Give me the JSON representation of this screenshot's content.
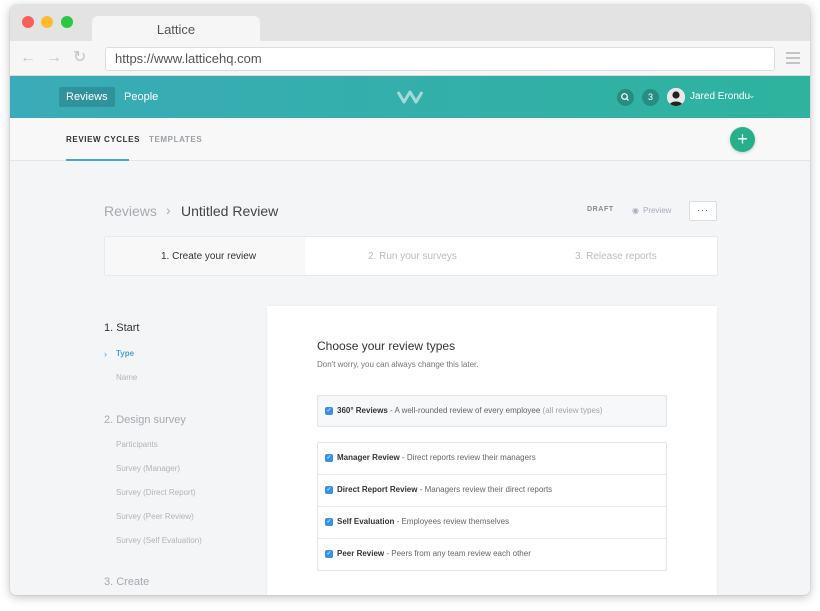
{
  "browser": {
    "tab_title": "Lattice",
    "url": "https://www.latticehq.com"
  },
  "header": {
    "nav": [
      {
        "label": "Reviews",
        "active": true
      },
      {
        "label": "People",
        "active": false
      }
    ],
    "notification_count": "3",
    "user_name": "Jared Erondu",
    "accent_gradient": [
      "#3aabb8",
      "#2db39e"
    ]
  },
  "subnav": {
    "tabs": [
      {
        "label": "REVIEW CYCLES",
        "active": true
      },
      {
        "label": "TEMPLATES",
        "active": false
      }
    ],
    "fab_label": "+"
  },
  "page": {
    "breadcrumb_root": "Reviews",
    "breadcrumb_current": "Untitled Review",
    "status": "DRAFT",
    "preview_label": "Preview",
    "more_label": "···"
  },
  "stepper": [
    {
      "label": "1. Create your review",
      "active": true
    },
    {
      "label": "2. Run your surveys",
      "active": false
    },
    {
      "label": "3. Release reports",
      "active": false
    }
  ],
  "outline": {
    "sections": [
      {
        "title": "1. Start",
        "items": [
          {
            "label": "Type",
            "active": true
          },
          {
            "label": "Name",
            "active": false
          }
        ]
      },
      {
        "title": "2. Design survey",
        "items": [
          {
            "label": "Participants"
          },
          {
            "label": "Survey (Manager)"
          },
          {
            "label": "Survey (Direct Report)"
          },
          {
            "label": "Survey (Peer Review)"
          },
          {
            "label": "Survey (Self Evaluation)"
          }
        ]
      },
      {
        "title": "3. Create",
        "items": []
      }
    ]
  },
  "review_types": {
    "title": "Choose your review types",
    "subtitle": "Don't worry, you can always change this later.",
    "all_option": {
      "name": "360° Reviews",
      "desc": " - A well-rounded review of every employee ",
      "note": "(all review types)",
      "checked": true
    },
    "options": [
      {
        "name": "Manager Review",
        "desc": " - Direct reports review their managers",
        "checked": true
      },
      {
        "name": "Direct Report Review",
        "desc": " - Managers review their direct reports",
        "checked": true
      },
      {
        "name": "Self Evaluation",
        "desc": " - Employees review themselves",
        "checked": true
      },
      {
        "name": "Peer Review",
        "desc": " - Peers from any team review each other",
        "checked": true
      }
    ]
  }
}
